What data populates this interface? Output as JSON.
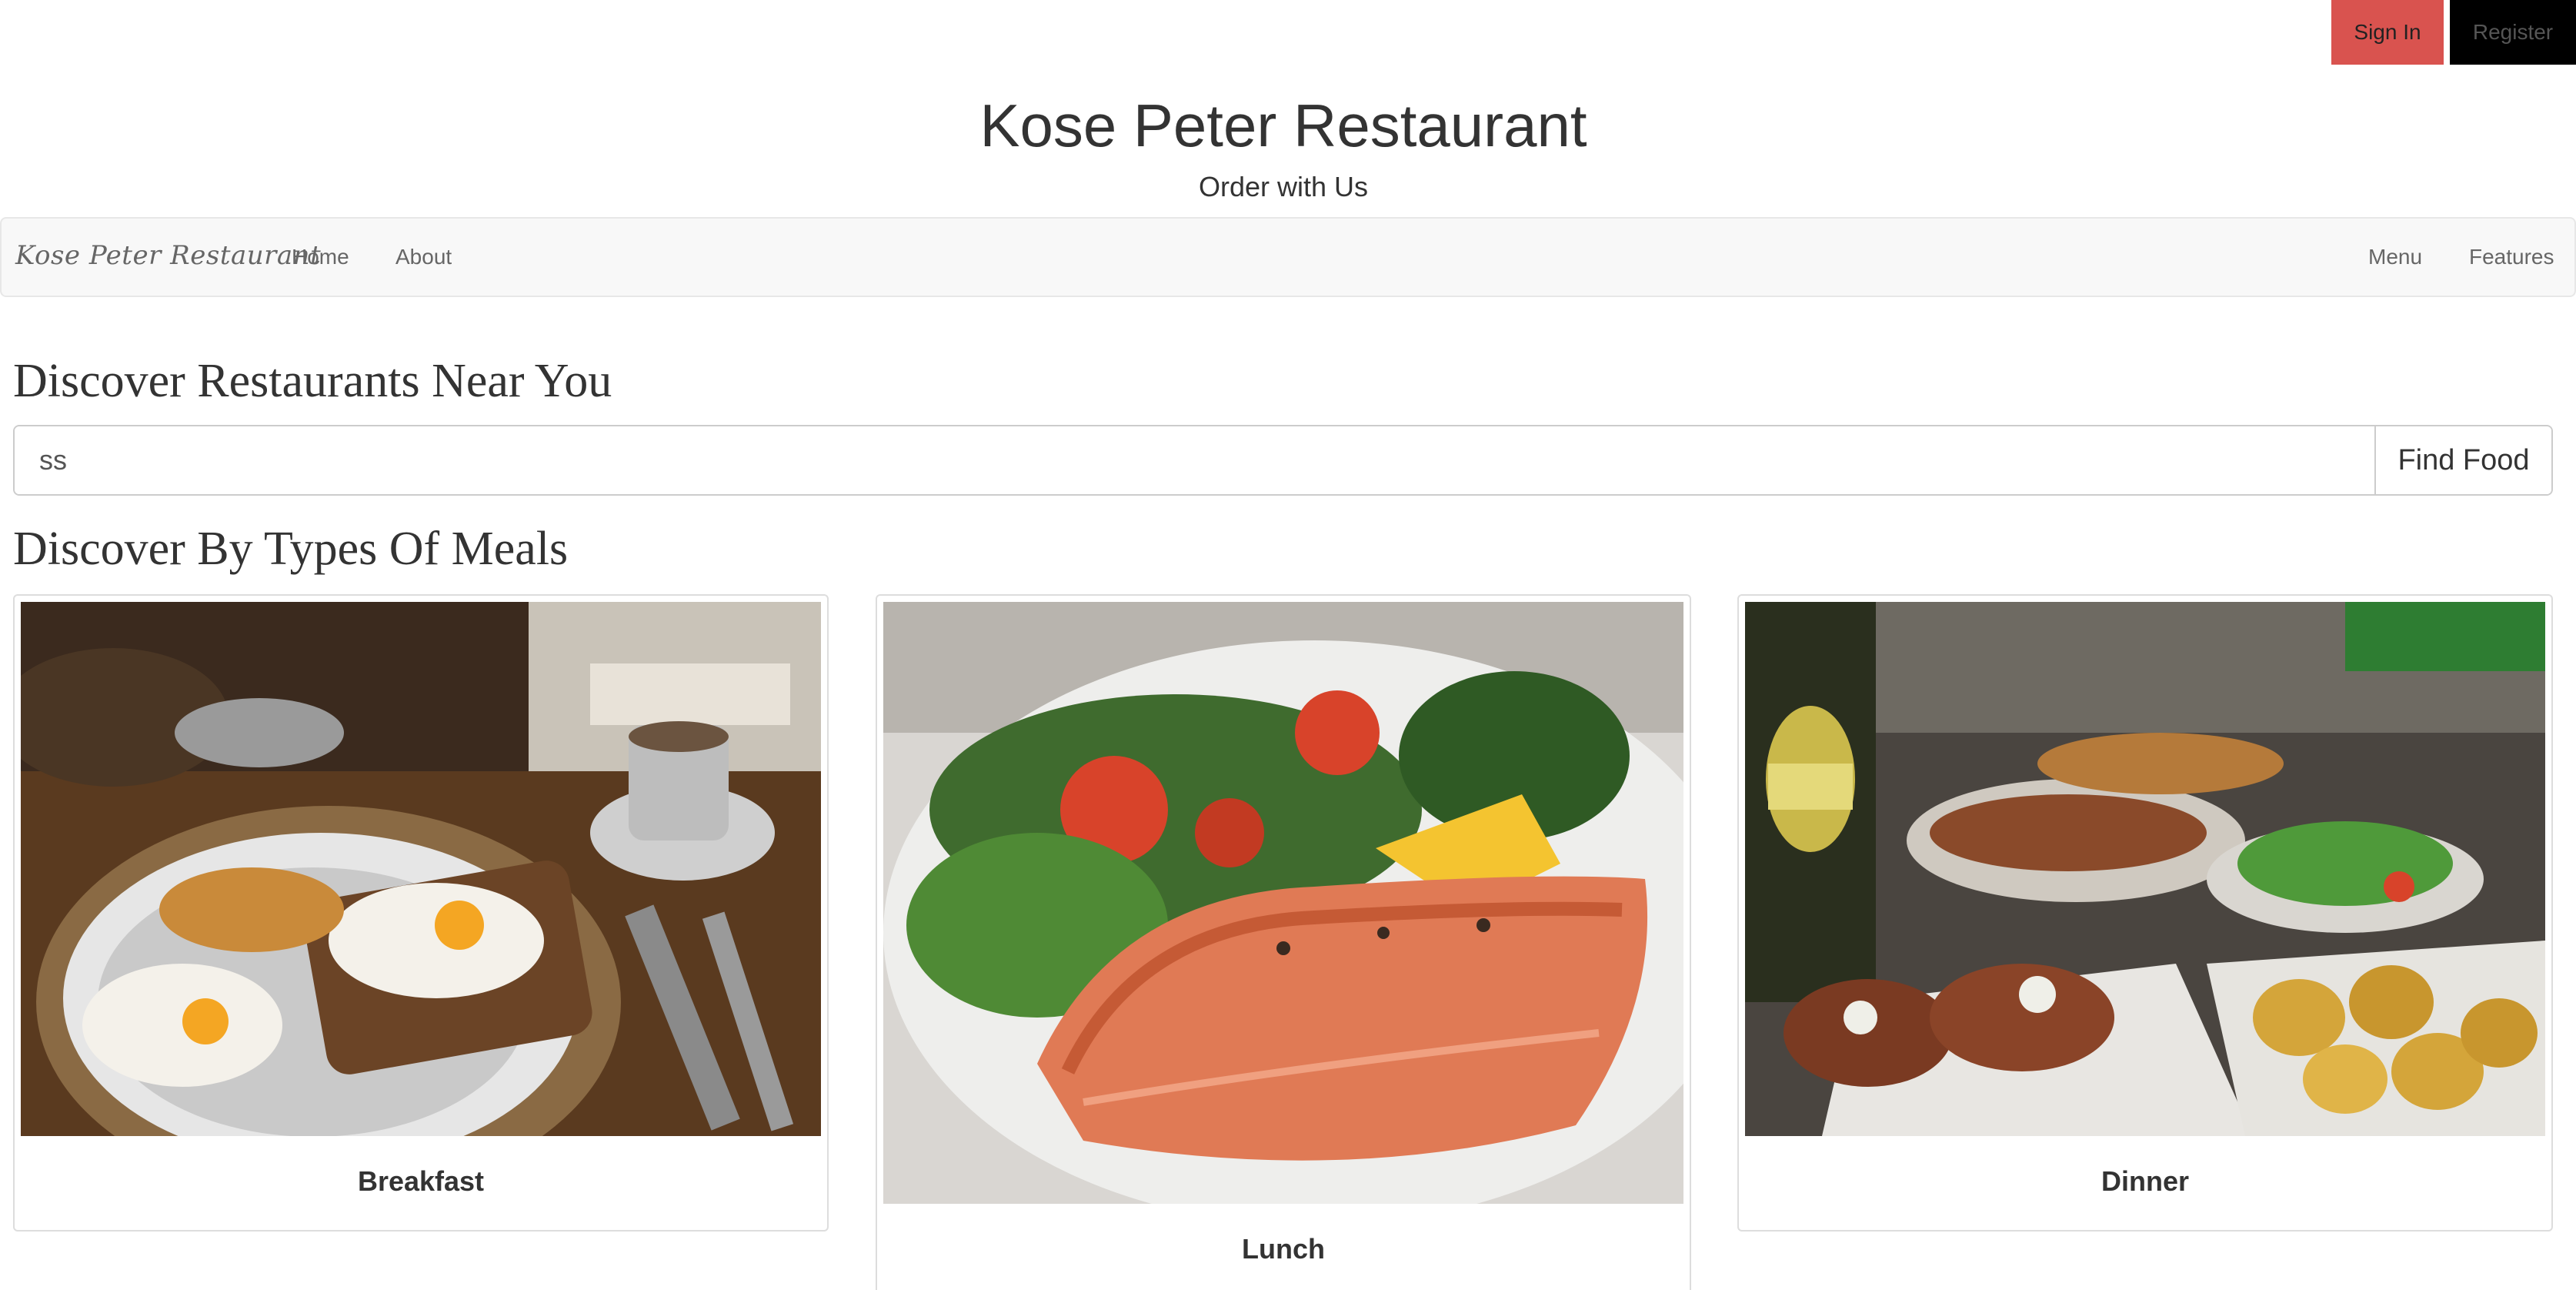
{
  "auth": {
    "sign_in": "Sign In",
    "register": "Register"
  },
  "header": {
    "title": "Kose Peter Restaurant",
    "subtitle": "Order with Us"
  },
  "navbar": {
    "brand": "Kose Peter Restaurant",
    "left_links": [
      "Home",
      "About"
    ],
    "right_links": [
      "Menu",
      "Features"
    ]
  },
  "discover": {
    "heading": "Discover Restaurants Near You",
    "search_value": "ss",
    "search_button": "Find Food"
  },
  "meals": {
    "heading": "Discover By Types Of Meals",
    "cards": [
      {
        "label": "Breakfast",
        "image": "breakfast-photo"
      },
      {
        "label": "Lunch",
        "image": "lunch-photo"
      },
      {
        "label": "Dinner",
        "image": "dinner-photo"
      }
    ]
  },
  "colors": {
    "sign_in_bg": "#d9534f",
    "register_bg": "#000000",
    "navbar_bg": "#f8f8f8"
  }
}
